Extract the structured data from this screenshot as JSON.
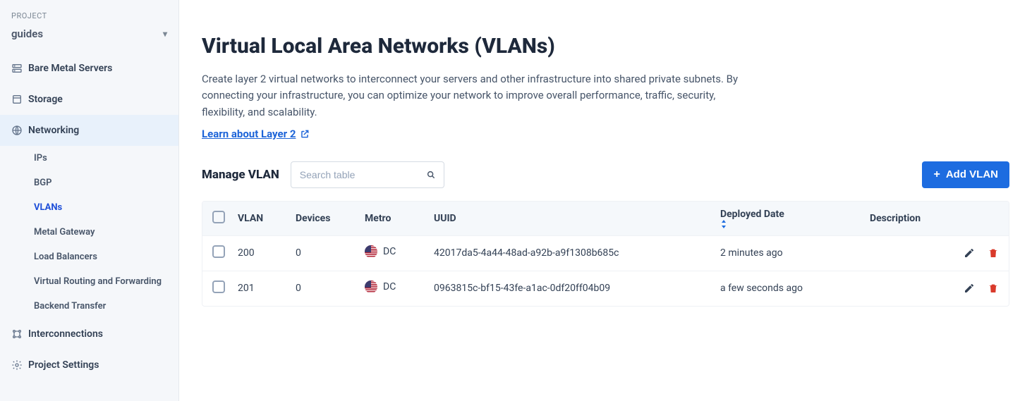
{
  "sidebar": {
    "project_label": "PROJECT",
    "project_name": "guides",
    "items": [
      {
        "label": "Bare Metal Servers",
        "icon": "server"
      },
      {
        "label": "Storage",
        "icon": "storage"
      },
      {
        "label": "Networking",
        "icon": "network",
        "active": true,
        "sub": [
          {
            "label": "IPs"
          },
          {
            "label": "BGP"
          },
          {
            "label": "VLANs",
            "active": true
          },
          {
            "label": "Metal Gateway"
          },
          {
            "label": "Load Balancers"
          },
          {
            "label": "Virtual Routing and Forwarding"
          },
          {
            "label": "Backend Transfer"
          }
        ]
      },
      {
        "label": "Interconnections",
        "icon": "interconnect"
      },
      {
        "label": "Project Settings",
        "icon": "settings"
      }
    ]
  },
  "page": {
    "title": "Virtual Local Area Networks (VLANs)",
    "description": "Create layer 2 virtual networks to interconnect your servers and other infrastructure into shared private subnets. By connecting your infrastructure, you can optimize your network to improve overall performance, traffic, security, flexibility, and scalability.",
    "learn_link": "Learn about Layer 2"
  },
  "toolbar": {
    "manage_label": "Manage VLAN",
    "search_placeholder": "Search table",
    "add_label": "Add VLAN"
  },
  "table": {
    "headers": {
      "vlan": "VLAN",
      "devices": "Devices",
      "metro": "Metro",
      "uuid": "UUID",
      "deployed": "Deployed Date",
      "description": "Description"
    },
    "rows": [
      {
        "vlan": "200",
        "devices": "0",
        "metro": "DC",
        "uuid": "42017da5-4a44-48ad-a92b-a9f1308b685c",
        "deployed": "2 minutes ago",
        "description": ""
      },
      {
        "vlan": "201",
        "devices": "0",
        "metro": "DC",
        "uuid": "0963815c-bf15-43fe-a1ac-0df20ff04b09",
        "deployed": "a few seconds ago",
        "description": ""
      }
    ]
  }
}
